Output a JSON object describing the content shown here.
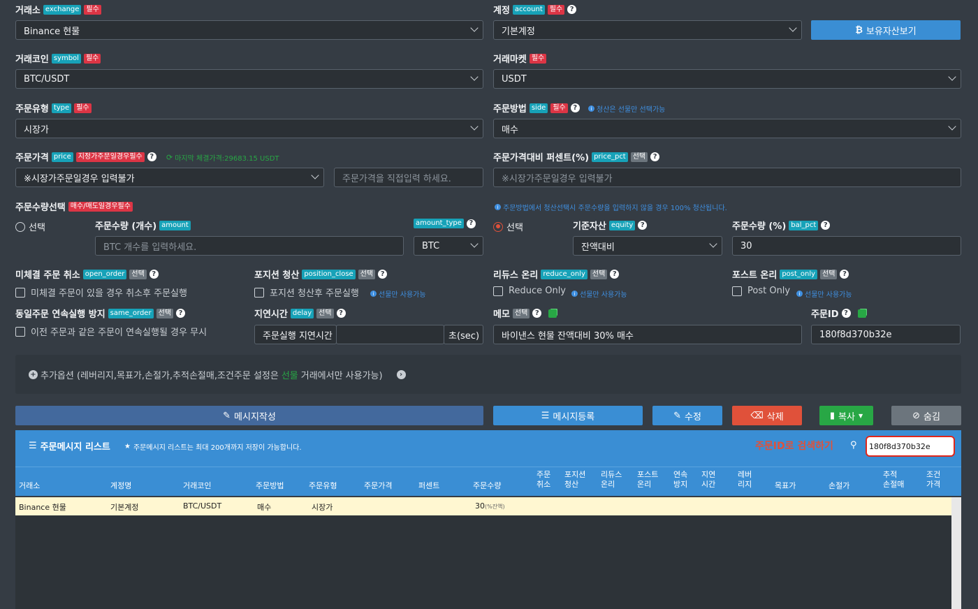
{
  "form": {
    "exchange": {
      "label": "거래소",
      "tag": "exchange",
      "req": "필수",
      "value": "Binance 현물"
    },
    "account": {
      "label": "계정",
      "tag": "account",
      "req": "필수",
      "value": "기본계정"
    },
    "holdings_button": "보유자산보기",
    "symbol": {
      "label": "거래코인",
      "tag": "symbol",
      "req": "필수",
      "value": "BTC/USDT"
    },
    "market": {
      "label": "거래마켓",
      "req": "필수",
      "value": "USDT"
    },
    "type": {
      "label": "주문유형",
      "tag": "type",
      "req": "필수",
      "value": "시장가"
    },
    "side": {
      "label": "주문방법",
      "tag": "side",
      "req": "필수",
      "hint": "청산은 선물만 선택가능",
      "value": "매수"
    },
    "price": {
      "label": "주문가격",
      "tag": "price",
      "req": "지정가주문일경우필수",
      "hint": "마지막 체결가격:29683.15 USDT",
      "select": "※시장가주문일경우 입력불가",
      "placeholder": "주문가격을 직접입력 하세요."
    },
    "price_pct": {
      "label": "주문가격대비 퍼센트(%)",
      "tag": "price_pct",
      "opt": "선택",
      "placeholder": "※시장가주문일경우 입력불가"
    },
    "qty_select": {
      "label": "주문수량선택",
      "req": "매수/매도일경우필수",
      "hint": "주문방법에서 청산선택시 주문수량을 입력하지 않을 경우 100% 청산됩니다."
    },
    "amount": {
      "radio": "선택",
      "label": "주문수량 (개수)",
      "tag": "amount",
      "placeholder": "BTC 개수를 입력하세요.",
      "type_tag": "amount_type",
      "type_value": "BTC"
    },
    "equity": {
      "radio": "선택",
      "label": "기준자산",
      "tag": "equity",
      "value": "잔액대비"
    },
    "bal_pct": {
      "label": "주문수량 (%)",
      "tag": "bal_pct",
      "value": "30"
    },
    "open_order": {
      "label": "미체결 주문 취소",
      "tag": "open_order",
      "opt": "선택",
      "check": "미체결 주문이 있을 경우 취소후 주문실행"
    },
    "position_close": {
      "label": "포지션 청산",
      "tag": "position_close",
      "opt": "선택",
      "check": "포지션 청산후 주문실행",
      "hint": "선물만 사용가능"
    },
    "reduce_only": {
      "label": "리듀스 온리",
      "tag": "reduce_only",
      "opt": "선택",
      "check": "Reduce Only",
      "hint": "선물만 사용가능"
    },
    "post_only": {
      "label": "포스트 온리",
      "tag": "post_only",
      "opt": "선택",
      "check": "Post Only",
      "hint": "선물만 사용가능"
    },
    "same_order": {
      "label": "동일주문 연속실행 방지",
      "tag": "same_order",
      "opt": "선택",
      "check": "이전 주문과 같은 주문이 연속실행될 경우 무시"
    },
    "delay": {
      "label": "지연시간",
      "tag": "delay",
      "opt": "선택",
      "prefix": "주문실행 지연시간",
      "value": "",
      "suffix": "초(sec)"
    },
    "memo": {
      "label": "메모",
      "opt": "선택",
      "value": "바이낸스 현물 잔액대비 30% 매수"
    },
    "order_id": {
      "label": "주문ID",
      "value": "180f8d370b32e"
    },
    "advanced": {
      "pre": "추가옵션 (레버리지,목표가,손절가,추적손절매,조건주문 설정은 ",
      "hl": "선물",
      "post": "거래에서만 사용가능)"
    }
  },
  "buttons": {
    "write": "메시지작성",
    "register": "메시지등록",
    "edit": "수정",
    "delete": "삭제",
    "copy": "복사",
    "hide": "숨김"
  },
  "list": {
    "title": "주문메시지 리스트",
    "note": "주문메시지 리스트는 최대 200개까지 저장이 가능합니다.",
    "search_label": "주문ID로 검색하기",
    "search_value": "180f8d370b32e",
    "headers": [
      "거래소",
      "계정명",
      "거래코인",
      "주문방법",
      "주문유형",
      "주문가격",
      "퍼센트",
      "주문수량",
      "주문|취소",
      "포지션|청산",
      "리듀스|온리",
      "포스트|온리",
      "연속|방지",
      "지연|시간",
      "레버|리지",
      "목표가",
      "손절가",
      "추적|손절매",
      "조건|가격"
    ],
    "rows": [
      {
        "exchange": "Binance 현물",
        "account": "기본계정",
        "symbol": "BTC/USDT",
        "side": "매수",
        "type": "시장가",
        "qty": "30",
        "qty_unit": "(%잔액)"
      }
    ]
  },
  "colors": {
    "primary": "#3a8ed4",
    "danger": "#e0513a",
    "success": "#28a745",
    "gray": "#6c757d",
    "highlight": "#fff7d1"
  }
}
